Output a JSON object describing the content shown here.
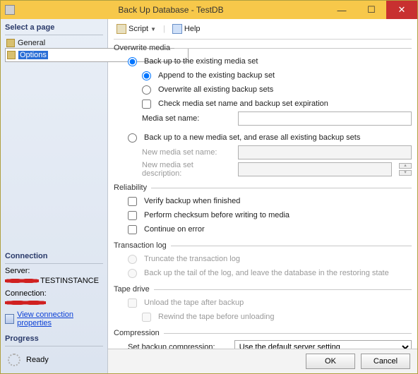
{
  "window": {
    "title": "Back Up Database - TestDB"
  },
  "toolbar": {
    "script": "Script",
    "help": "Help"
  },
  "sidebar": {
    "select_page": "Select a page",
    "general": "General",
    "options": "Options",
    "connection_head": "Connection",
    "server_label": "Server:",
    "server_suffix": "TESTINSTANCE",
    "connection_label": "Connection:",
    "view_props": "View connection properties",
    "progress_head": "Progress",
    "ready": "Ready"
  },
  "overwrite": {
    "title": "Overwrite media",
    "existing": "Back up to the existing media set",
    "append": "Append to the existing backup set",
    "overwrite_all": "Overwrite all existing backup sets",
    "check_media": "Check media set name and backup set expiration",
    "media_set_name": "Media set name:",
    "new_media": "Back up to a new media set, and erase all existing backup sets",
    "new_name": "New media set name:",
    "new_desc": "New media set description:"
  },
  "reliability": {
    "title": "Reliability",
    "verify": "Verify backup when finished",
    "checksum": "Perform checksum before writing to media",
    "cont_error": "Continue on error"
  },
  "tlog": {
    "title": "Transaction log",
    "truncate": "Truncate the transaction log",
    "tail": "Back up the tail of the log, and leave the database in the restoring state"
  },
  "tape": {
    "title": "Tape drive",
    "unload": "Unload the tape after backup",
    "rewind": "Rewind the tape before unloading"
  },
  "compression": {
    "title": "Compression",
    "label": "Set backup compression:",
    "value": "Use the default server setting"
  },
  "footer": {
    "ok": "OK",
    "cancel": "Cancel"
  }
}
